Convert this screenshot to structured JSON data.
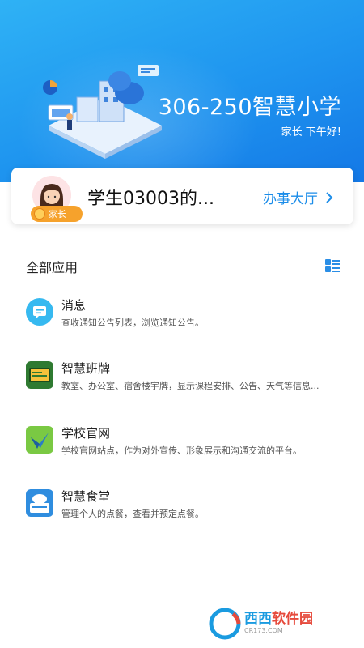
{
  "header": {
    "school_name": "306-250智慧小学",
    "greeting": "家长 下午好!"
  },
  "profile": {
    "role_badge": "家长",
    "student_name": "学生03003的...",
    "service_link": "办事大厅"
  },
  "apps_section": {
    "title": "全部应用",
    "items": [
      {
        "name": "消息",
        "desc": "查收通知公告列表，浏览通知公告。",
        "icon": "message-icon",
        "color": "#36b9f0"
      },
      {
        "name": "智慧班牌",
        "desc": "教室、办公室、宿舍楼宇牌，显示课程安排、公告、天气等信息...",
        "icon": "class-board-icon",
        "color": "#3a8f3c"
      },
      {
        "name": "学校官网",
        "desc": "学校官网站点，作为对外宣传、形象展示和沟通交流的平台。",
        "icon": "school-website-icon",
        "color": "#6cbf3a"
      },
      {
        "name": "智慧食堂",
        "desc": "管理个人的点餐，查看并预定点餐。",
        "icon": "canteen-icon",
        "color": "#2f8ddf"
      }
    ]
  },
  "watermark": {
    "main_blue": "西西",
    "main_red": "软件园",
    "sub": "CR173.COM"
  }
}
